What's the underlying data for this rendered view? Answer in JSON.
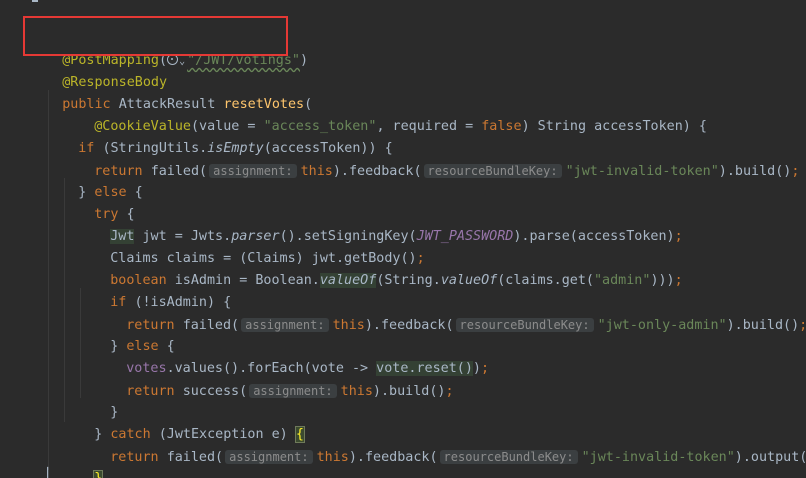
{
  "colors": {
    "background": "#2b2b2b",
    "keyword": "#cc7832",
    "annotation": "#bbb529",
    "string": "#6a8759",
    "method_declaration": "#ffc66d",
    "constant": "#9876aa",
    "plain": "#a9b7c6",
    "highlight_box": "#e53935"
  },
  "code": {
    "l1": {
      "annotation": "@PostMapping",
      "open": "(",
      "path": "\"/JWT/votings\"",
      "close": ")"
    },
    "l2": {
      "annotation": "@ResponseBody"
    },
    "l3": {
      "kw": "public ",
      "type": "AttackResult ",
      "name": "resetVotes",
      "open": "("
    },
    "l4": {
      "annotation": "@CookieValue",
      "a": "(value = ",
      "s1": "\"access_token\"",
      "b": ", required = ",
      "kw": "false",
      "c": ") String accessToken) {"
    },
    "l5": {
      "kw": "if ",
      "a": "(StringUtils.",
      "m": "isEmpty",
      "b": "(accessToken)) {"
    },
    "l6": {
      "kw": "return ",
      "a": "failed(",
      "hint1": "assignment:",
      "kw2": "this",
      "b": ").feedback(",
      "hint2": "resourceBundleKey:",
      "s": "\"jwt-invalid-token\"",
      "c": ").build()",
      "semi": ";"
    },
    "l7": {
      "a": "} ",
      "kw": "else",
      "b": " {"
    },
    "l8": {
      "kw": "try ",
      "a": "{"
    },
    "l9": {
      "type": "Jwt",
      "a": " jwt = Jwts.",
      "m": "parser",
      "b": "().setSigningKey(",
      "const": "JWT_PASSWORD",
      "c": ").parse(accessToken)",
      "semi": ";"
    },
    "l10": {
      "a": "Claims claims = (Claims) jwt.getBody()",
      "semi": ";"
    },
    "l11": {
      "kw": "boolean ",
      "a": "isAdmin = Boolean.",
      "m1": "valueOf",
      "b": "(String.",
      "m2": "valueOf",
      "c": "(claims.get(",
      "s": "\"admin\"",
      "d": ")))",
      "semi": ";"
    },
    "l12": {
      "kw": "if ",
      "a": "(!isAdmin) {"
    },
    "l13": {
      "kw": "return ",
      "a": "failed(",
      "hint1": "assignment:",
      "kw2": "this",
      "b": ").feedback(",
      "hint2": "resourceBundleKey:",
      "s": "\"jwt-only-admin\"",
      "c": ").build()",
      "semi": ";"
    },
    "l14": {
      "a": "} ",
      "kw": "else",
      "b": " {"
    },
    "l15": {
      "field": "votes",
      "a": ".values().forEach(vote -> ",
      "b": "vote.reset()",
      "c": ")",
      "semi": ";"
    },
    "l16": {
      "kw": "return ",
      "a": "success(",
      "hint1": "assignment:",
      "kw2": "this",
      "b": ").build()",
      "semi": ";"
    },
    "l17": {
      "a": "}"
    },
    "l18": {
      "a": "} ",
      "kw": "catch ",
      "b": "(JwtException e) ",
      "brace": "{"
    },
    "l19": {
      "kw": "return ",
      "a": "failed(",
      "hint1": "assignment:",
      "kw2": "this",
      "b": ").feedback(",
      "hint2": "resourceBundleKey:",
      "s": "\"jwt-invalid-token\"",
      "c": ").output(e.toStri"
    },
    "l20": {
      "brace": "}"
    }
  }
}
